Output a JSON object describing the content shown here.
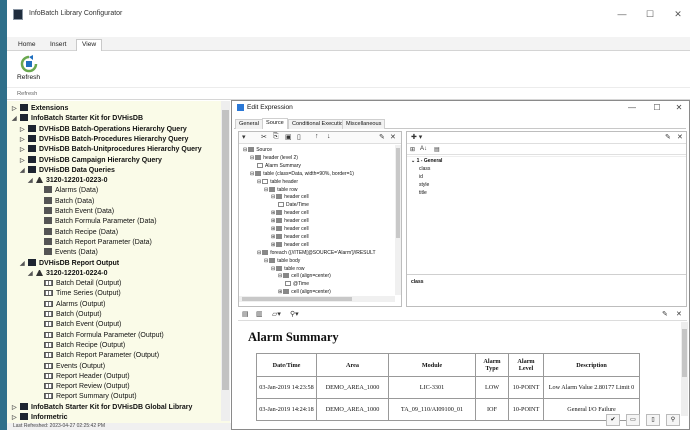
{
  "window": {
    "title": "InfoBatch Library Configurator"
  },
  "ribbon": {
    "tabs": [
      {
        "label": "Home"
      },
      {
        "label": "Insert"
      },
      {
        "label": "View"
      }
    ],
    "refresh_label": "Refresh",
    "group_label": "Refresh"
  },
  "tree": {
    "items": [
      {
        "label": "Extensions",
        "level": 0,
        "bold": true,
        "expander": "▷",
        "icon": "book"
      },
      {
        "label": "InfoBatch Starter Kit for DVHisDB",
        "level": 0,
        "bold": true,
        "expander": "◢",
        "icon": "book"
      },
      {
        "label": "DVHisDB Batch-Operations Hierarchy Query",
        "level": 1,
        "bold": true,
        "expander": "▷",
        "icon": "book"
      },
      {
        "label": "DVHisDB Batch-Procedures Hierarchy Query",
        "level": 1,
        "bold": true,
        "expander": "▷",
        "icon": "book"
      },
      {
        "label": "DVHisDB Batch-Unitprocedures Hierarchy Query",
        "level": 1,
        "bold": true,
        "expander": "▷",
        "icon": "book"
      },
      {
        "label": "DVHisDB Campaign Hierarchy Query",
        "level": 1,
        "bold": true,
        "expander": "▷",
        "icon": "book"
      },
      {
        "label": "DVHisDB Data Queries",
        "level": 1,
        "bold": true,
        "expander": "◢",
        "icon": "book"
      },
      {
        "label": "3120-12201-0223-0",
        "level": 2,
        "bold": true,
        "expander": "◢",
        "icon": "person"
      },
      {
        "label": "Alarms (Data)",
        "level": 3,
        "bold": false,
        "expander": "",
        "icon": "table"
      },
      {
        "label": "Batch (Data)",
        "level": 3,
        "bold": false,
        "expander": "",
        "icon": "table"
      },
      {
        "label": "Batch Event (Data)",
        "level": 3,
        "bold": false,
        "expander": "",
        "icon": "table"
      },
      {
        "label": "Batch Formula Parameter (Data)",
        "level": 3,
        "bold": false,
        "expander": "",
        "icon": "table"
      },
      {
        "label": "Batch Recipe (Data)",
        "level": 3,
        "bold": false,
        "expander": "",
        "icon": "table"
      },
      {
        "label": "Batch Report Parameter (Data)",
        "level": 3,
        "bold": false,
        "expander": "",
        "icon": "table"
      },
      {
        "label": "Events (Data)",
        "level": 3,
        "bold": false,
        "expander": "",
        "icon": "table"
      },
      {
        "label": "DVHisDB Report Output",
        "level": 1,
        "bold": true,
        "expander": "◢",
        "icon": "book"
      },
      {
        "label": "3120-12201-0224-0",
        "level": 2,
        "bold": true,
        "expander": "◢",
        "icon": "person"
      },
      {
        "label": "Batch Detail (Output)",
        "level": 3,
        "bold": false,
        "expander": "",
        "icon": "grid"
      },
      {
        "label": "Time Series (Output)",
        "level": 3,
        "bold": false,
        "expander": "",
        "icon": "grid"
      },
      {
        "label": "Alarms (Output)",
        "level": 3,
        "bold": false,
        "expander": "",
        "icon": "grid"
      },
      {
        "label": "Batch (Output)",
        "level": 3,
        "bold": false,
        "expander": "",
        "icon": "grid"
      },
      {
        "label": "Batch Event (Output)",
        "level": 3,
        "bold": false,
        "expander": "",
        "icon": "grid"
      },
      {
        "label": "Batch Formula Parameter (Output)",
        "level": 3,
        "bold": false,
        "expander": "",
        "icon": "grid"
      },
      {
        "label": "Batch Recipe (Output)",
        "level": 3,
        "bold": false,
        "expander": "",
        "icon": "grid"
      },
      {
        "label": "Batch Report Parameter (Output)",
        "level": 3,
        "bold": false,
        "expander": "",
        "icon": "grid"
      },
      {
        "label": "Events (Output)",
        "level": 3,
        "bold": false,
        "expander": "",
        "icon": "grid"
      },
      {
        "label": "Report Header (Output)",
        "level": 3,
        "bold": false,
        "expander": "",
        "icon": "grid"
      },
      {
        "label": "Report Review (Output)",
        "level": 3,
        "bold": false,
        "expander": "",
        "icon": "grid"
      },
      {
        "label": "Report Summary (Output)",
        "level": 3,
        "bold": false,
        "expander": "",
        "icon": "grid"
      },
      {
        "label": "InfoBatch Starter Kit for DVHisDB Global Library",
        "level": 0,
        "bold": true,
        "expander": "▷",
        "icon": "book"
      },
      {
        "label": "Informetric",
        "level": 0,
        "bold": true,
        "expander": "▷",
        "icon": "book"
      }
    ]
  },
  "status": {
    "text": "Last Refreshed: 2023-04-27 02:25:42 PM"
  },
  "dialog": {
    "title": "Edit Expression",
    "tabs": [
      "General",
      "Source",
      "Conditional Execution",
      "Miscellaneous"
    ],
    "source_tree": [
      {
        "label": "Source",
        "level": 0,
        "exp": "⊟",
        "icon": "ic"
      },
      {
        "label": "header (level 2)",
        "level": 1,
        "exp": "⊟",
        "icon": "ic"
      },
      {
        "label": "Alarm Summary",
        "level": 2,
        "exp": "",
        "icon": "doc"
      },
      {
        "label": "table (class=Data, width=90%, border=1)",
        "level": 1,
        "exp": "⊟",
        "icon": "ic"
      },
      {
        "label": "table header",
        "level": 2,
        "exp": "⊟",
        "icon": "doc"
      },
      {
        "label": "table row",
        "level": 3,
        "exp": "⊟",
        "icon": "ic"
      },
      {
        "label": "header cell",
        "level": 4,
        "exp": "⊟",
        "icon": "ic"
      },
      {
        "label": "Date/Time",
        "level": 5,
        "exp": "",
        "icon": "doc"
      },
      {
        "label": "header cell",
        "level": 4,
        "exp": "⊞",
        "icon": "ic"
      },
      {
        "label": "header cell",
        "level": 4,
        "exp": "⊞",
        "icon": "ic"
      },
      {
        "label": "header cell",
        "level": 4,
        "exp": "⊞",
        "icon": "ic"
      },
      {
        "label": "header cell",
        "level": 4,
        "exp": "⊞",
        "icon": "ic"
      },
      {
        "label": "header cell",
        "level": 4,
        "exp": "⊞",
        "icon": "ic"
      },
      {
        "label": "foreach ({//ITEM[@SOURCE='Alarm']//RESULT",
        "level": 2,
        "exp": "⊟",
        "icon": "ic"
      },
      {
        "label": "table body",
        "level": 3,
        "exp": "⊟",
        "icon": "ic"
      },
      {
        "label": "table row",
        "level": 4,
        "exp": "⊟",
        "icon": "ic"
      },
      {
        "label": "cell (align=center)",
        "level": 5,
        "exp": "⊟",
        "icon": "ic"
      },
      {
        "label": "@Time",
        "level": 6,
        "exp": "",
        "icon": "doc"
      },
      {
        "label": "cell (align=center)",
        "level": 5,
        "exp": "⊞",
        "icon": "ic"
      }
    ],
    "props": {
      "category": "1 - General",
      "rows": [
        "class",
        "id",
        "style",
        "title"
      ],
      "desc_label": "class"
    },
    "report": {
      "title": "Alarm Summary",
      "headers": [
        "Date/Time",
        "Area",
        "Module",
        "Alarm Type",
        "Alarm Level",
        "Description"
      ],
      "rows": [
        [
          "03-Jan-2019 14:23:58",
          "DEMO_AREA_1000",
          "LIC-3301",
          "LOW",
          "10-POINT",
          "Low Alarm Value 2.80177 Limit 0"
        ],
        [
          "03-Jan-2019 14:24:18",
          "DEMO_AREA_1000",
          "TA_09_110/AI09100_01",
          "IOF",
          "10-POINT",
          "General I/O Failure"
        ]
      ]
    }
  }
}
